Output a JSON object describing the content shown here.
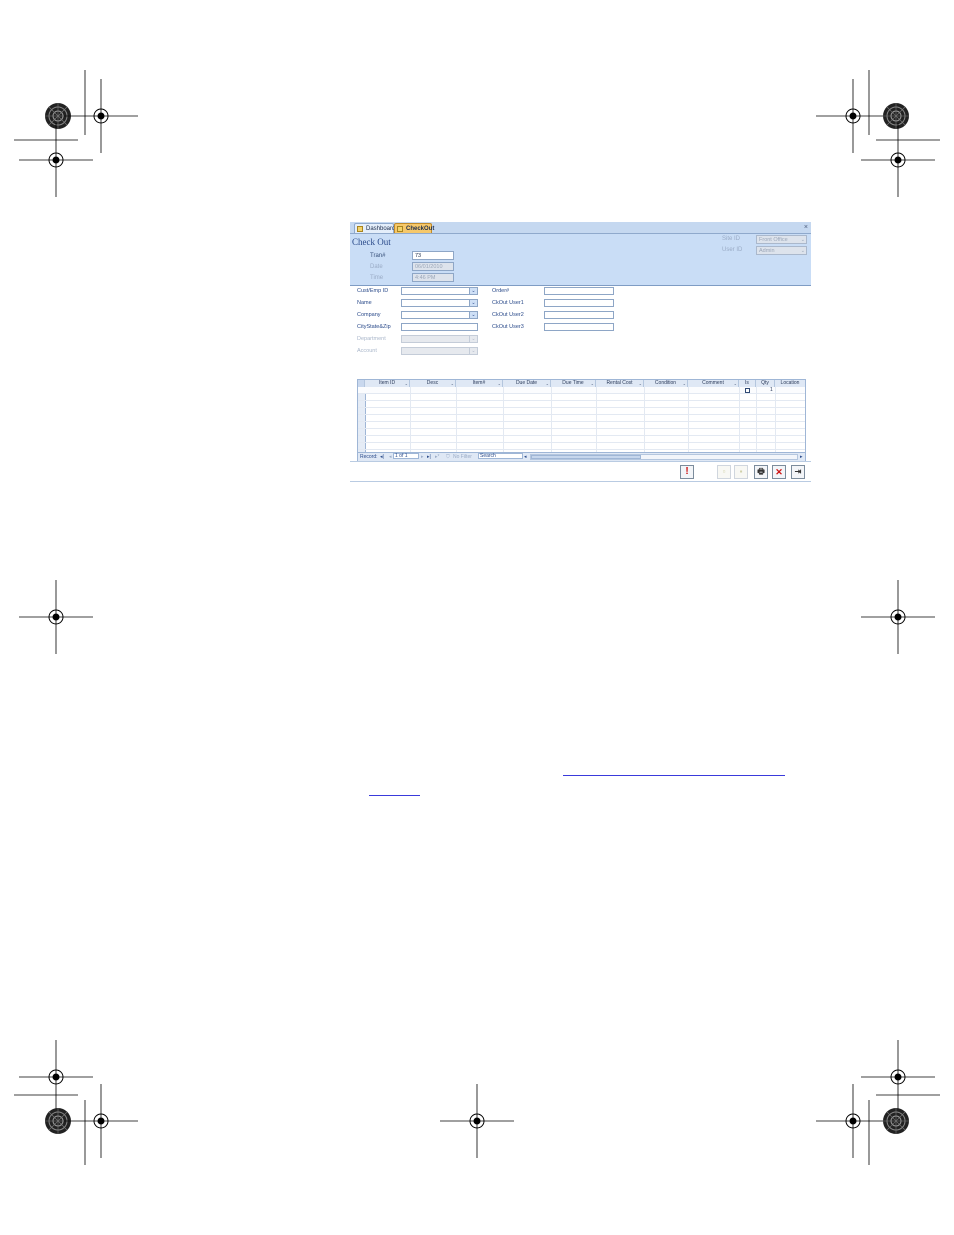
{
  "colors": {
    "accent": "#c9ddf6",
    "active_tab": "#f6c86a",
    "link": "#3a3adb",
    "stop_red": "#cc1111"
  },
  "tabs": [
    {
      "label": "Dashboard",
      "icon": "form-icon"
    },
    {
      "label": "CheckOut",
      "icon": "form-icon",
      "active": true
    }
  ],
  "tab_close": "×",
  "form": {
    "title": "Check Out",
    "header_fields": [
      {
        "label": "Tran#",
        "value": "73"
      },
      {
        "label": "Date",
        "value": "06/01/2010"
      },
      {
        "label": "Time",
        "value": "4:46 PM"
      }
    ],
    "header_right": [
      {
        "label": "Site ID",
        "value": "Front Office"
      },
      {
        "label": "User ID",
        "value": "Admin"
      }
    ]
  },
  "left_fields": [
    {
      "label": "Cust/Emp ID",
      "value": ""
    },
    {
      "label": "Name",
      "value": ""
    },
    {
      "label": "Company",
      "value": ""
    },
    {
      "label": "CityState&Zip",
      "value": ""
    },
    {
      "label": "Department",
      "value": ""
    },
    {
      "label": "Account",
      "value": ""
    }
  ],
  "right_fields": [
    {
      "label": "Order#",
      "value": ""
    },
    {
      "label": "CkOut User1",
      "value": ""
    },
    {
      "label": "CkOut User2",
      "value": ""
    },
    {
      "label": "CkOut User3",
      "value": ""
    }
  ],
  "grid": {
    "columns": [
      "Item ID",
      "Desc",
      "Item#",
      "Due Date",
      "Due Time",
      "Rental Cost",
      "Condition",
      "Comment",
      "Is",
      "Qty",
      "Location"
    ],
    "new_row": {
      "qty": "1",
      "row_marker": "▶"
    }
  },
  "nav": {
    "record_label": "Record:",
    "position": "1 of 1",
    "filter": "No Filter",
    "search": "Search"
  },
  "dropdown_glyph": "⌄",
  "toolbar": [
    {
      "name": "alert-button",
      "icon": "exclamation-icon",
      "glyph": "!"
    },
    {
      "name": "new-record-button",
      "icon": "document-icon",
      "glyph": "▫"
    },
    {
      "name": "save-button",
      "icon": "save-icon",
      "glyph": "▪"
    },
    {
      "name": "print-button",
      "icon": "printer-icon",
      "glyph": "🖶"
    },
    {
      "name": "delete-button",
      "icon": "close-x-icon",
      "glyph": "✕"
    },
    {
      "name": "exit-button",
      "icon": "exit-door-icon",
      "glyph": "⇥"
    }
  ]
}
